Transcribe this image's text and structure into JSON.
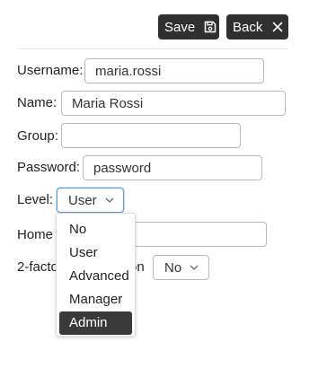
{
  "toolbar": {
    "save_label": "Save",
    "save_icon": "floppy-disk-icon",
    "back_label": "Back",
    "back_icon": "close-icon"
  },
  "form": {
    "username": {
      "label": "Username:",
      "value": "maria.rossi"
    },
    "name": {
      "label": "Name:",
      "value": "Maria Rossi"
    },
    "group": {
      "label": "Group:",
      "value": ""
    },
    "password": {
      "label": "Password:",
      "value": "password"
    },
    "level": {
      "label": "Level:",
      "value": "User",
      "options": [
        "No",
        "User",
        "Advanced",
        "Manager",
        "Admin"
      ],
      "highlighted_option": "Admin"
    },
    "home": {
      "label_visible": "Home U",
      "value": ""
    },
    "twofactor": {
      "label_left": "2-facto",
      "label_right": "on",
      "value": "No"
    }
  },
  "colors": {
    "button_bg": "#303030",
    "button_text": "#ffffff",
    "focus_border": "#5b9bd5",
    "highlight_bg": "#3a3a3a"
  }
}
